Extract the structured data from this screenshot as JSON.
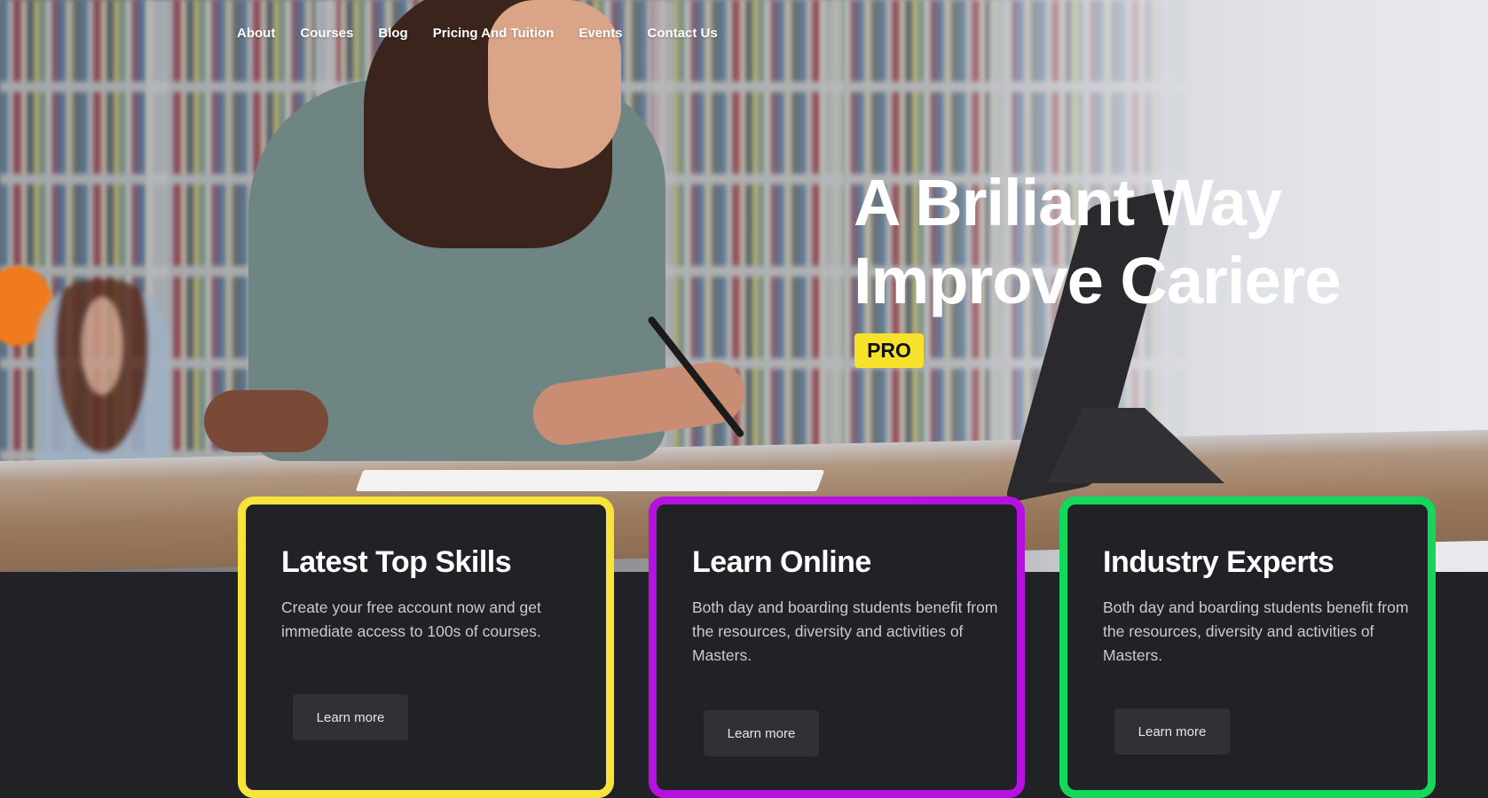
{
  "colors": {
    "background": "#212226",
    "accent_yellow": "#f6e12c",
    "card1_border": "#f6e33c",
    "card2_border": "#b512e0",
    "card3_border": "#14d85c",
    "text_white": "#ffffff",
    "text_muted": "#c9cbd0"
  },
  "nav": {
    "items": [
      {
        "label": "About"
      },
      {
        "label": "Courses"
      },
      {
        "label": "Blog"
      },
      {
        "label": "Pricing And Tuition"
      },
      {
        "label": "Events"
      },
      {
        "label": "Contact Us"
      }
    ]
  },
  "hero": {
    "headline_line1": "A Briliant Way",
    "headline_line2": "Improve Cariere",
    "badge": "PRO"
  },
  "cards": [
    {
      "title": "Latest Top Skills",
      "text": "Create your free account now and get immediate access to 100s of courses.",
      "button": "Learn more"
    },
    {
      "title": "Learn Online",
      "text": "Both day and boarding students benefit from the resources, diversity and activities of Masters.",
      "button": "Learn more"
    },
    {
      "title": "Industry Experts",
      "text": "Both day and boarding students benefit from the resources, diversity and activities of Masters.",
      "button": "Learn more"
    }
  ]
}
